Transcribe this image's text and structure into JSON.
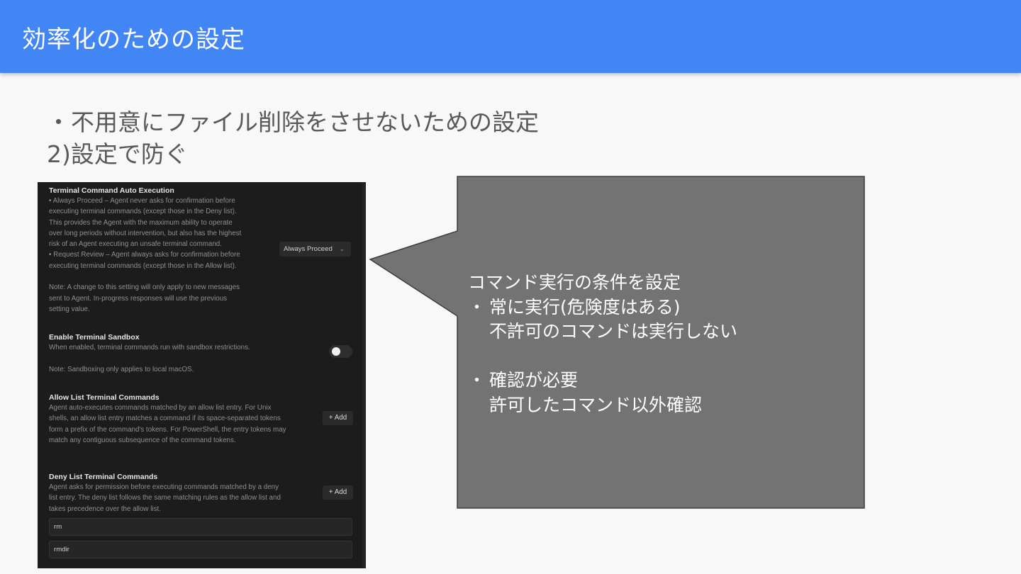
{
  "slide": {
    "title": "効率化のための設定",
    "subtitle_bullet": "・",
    "subtitle_line1": "不用意にファイル削除をさせないための設定",
    "subtitle_line2": "2)設定で防ぐ"
  },
  "settings": {
    "auto_exec": {
      "title": "Terminal Command Auto Execution",
      "description": "• Always Proceed – Agent never asks for confirmation before\nexecuting terminal commands (except those in the Deny list).\nThis provides the Agent with the maximum ability to operate\nover long periods without intervention, but also has the highest\nrisk of an Agent executing an unsafe terminal command.\n• Request Review – Agent always asks for confirmation before\nexecuting terminal commands (except those in the Allow list).\n\nNote: A change to this setting will only apply to new messages\nsent to Agent. In-progress responses will use the previous\nsetting value.",
      "dropdown_value": "Always Proceed"
    },
    "sandbox": {
      "title": "Enable Terminal Sandbox",
      "description": "When enabled, terminal commands run with sandbox restrictions.\n\nNote: Sandboxing only applies to local macOS.",
      "enabled": false
    },
    "allow_list": {
      "title": "Allow List Terminal Commands",
      "description": "Agent auto-executes commands matched by an allow list entry. For Unix\nshells, an allow list entry matches a command if its space-separated tokens\nform a prefix of the command's tokens. For PowerShell, the entry tokens may\nmatch any contiguous subsequence of the command tokens.",
      "add_label": "+ Add"
    },
    "deny_list": {
      "title": "Deny List Terminal Commands",
      "description": "Agent asks for permission before executing commands matched by a deny\nlist entry. The deny list follows the same matching rules as the allow list and\ntakes precedence over the allow list.",
      "add_label": "+ Add",
      "entries": [
        "rm",
        "rmdir"
      ]
    }
  },
  "callout": {
    "heading": "コマンド実行の条件を設定",
    "bullet": "・",
    "item1_title": "常に実行(危険度はある)",
    "item1_sub": "不許可のコマンドは実行しない",
    "item2_title": "確認が必要",
    "item2_sub": "許可したコマンド以外確認"
  },
  "colors": {
    "header": "#4285f4",
    "callout_fill": "#737373",
    "panel_bg": "#1c1c1c"
  }
}
